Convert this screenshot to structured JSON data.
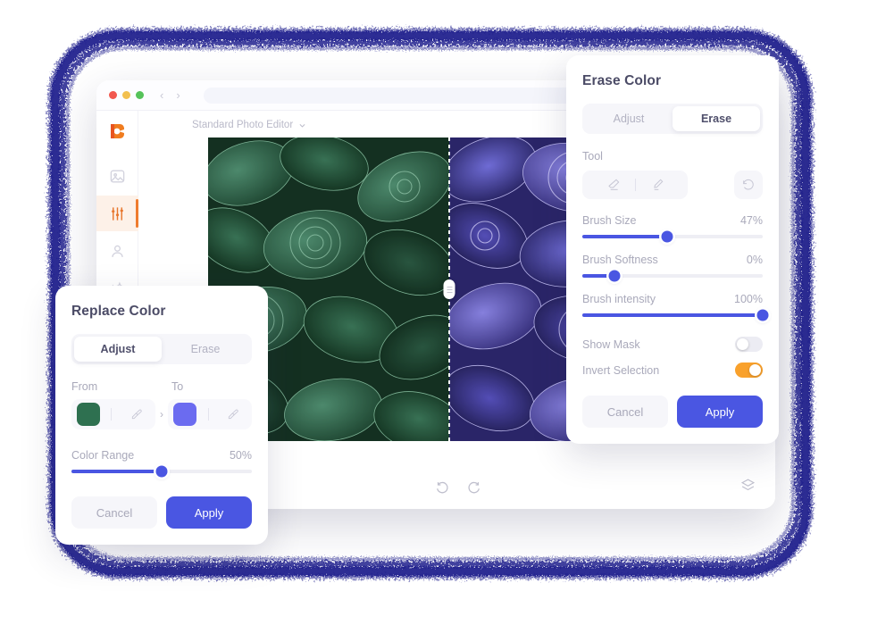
{
  "theme": {
    "accent_blue": "#4a56e2",
    "accent_orange": "#ef7c2e",
    "toggle_on": "#f9a12c",
    "panel_bg": "#ffffff",
    "muted_text": "#a9a9ba",
    "scribble": "#2a2a8c"
  },
  "app_window": {
    "titlebar": {
      "traffic_lights": [
        "close-red",
        "minimize-yellow",
        "maximize-green"
      ],
      "back_arrow": "‹",
      "forward_arrow": "›",
      "address_value": "",
      "address_placeholder": ""
    },
    "sidebar": {
      "logo": "app-logo",
      "items": [
        {
          "icon": "image-icon",
          "name": "media",
          "active": false
        },
        {
          "icon": "sliders-icon",
          "name": "adjust",
          "active": true
        },
        {
          "icon": "person-icon",
          "name": "portrait",
          "active": false
        },
        {
          "icon": "sparkle-icon",
          "name": "effects",
          "active": false
        }
      ]
    },
    "preset_menu": {
      "label": "Standard Photo Editor",
      "chevron": "⌄"
    },
    "canvas": {
      "before_label": "original-green-succulents",
      "after_label": "recolored-purple-succulents",
      "divider_position_pct": 50
    },
    "bottom_toolbar": {
      "undo_icon": "undo-icon",
      "redo_icon": "redo-icon",
      "layers_icon": "layers-icon"
    }
  },
  "erase_panel": {
    "title": "Erase Color",
    "tabs": [
      {
        "label": "Adjust",
        "active": false
      },
      {
        "label": "Erase",
        "active": true
      }
    ],
    "tool_section_label": "Tool",
    "tools": [
      {
        "icon": "eraser-icon",
        "name": "eraser",
        "active": false
      },
      {
        "icon": "brush-icon",
        "name": "brush",
        "active": false
      }
    ],
    "reset_icon": "reset-icon",
    "sliders": [
      {
        "label": "Brush Size",
        "value": "47%",
        "percent": 47
      },
      {
        "label": "Brush Softness",
        "value": "0%",
        "percent": 18
      },
      {
        "label": "Brush intensity",
        "value": "100%",
        "percent": 100
      }
    ],
    "toggles": [
      {
        "label": "Show Mask",
        "on": false
      },
      {
        "label": "Invert Selection",
        "on": true
      }
    ],
    "cancel_label": "Cancel",
    "apply_label": "Apply"
  },
  "replace_panel": {
    "title": "Replace Color",
    "tabs": [
      {
        "label": "Adjust",
        "active": true
      },
      {
        "label": "Erase",
        "active": false
      }
    ],
    "from_label": "From",
    "to_label": "To",
    "from_color": "#2e7050",
    "to_color": "#6b6bf0",
    "arrow": "›",
    "eyedropper_icon": "eyedropper-icon",
    "slider": {
      "label": "Color Range",
      "value": "50%",
      "percent": 50
    },
    "cancel_label": "Cancel",
    "apply_label": "Apply"
  }
}
